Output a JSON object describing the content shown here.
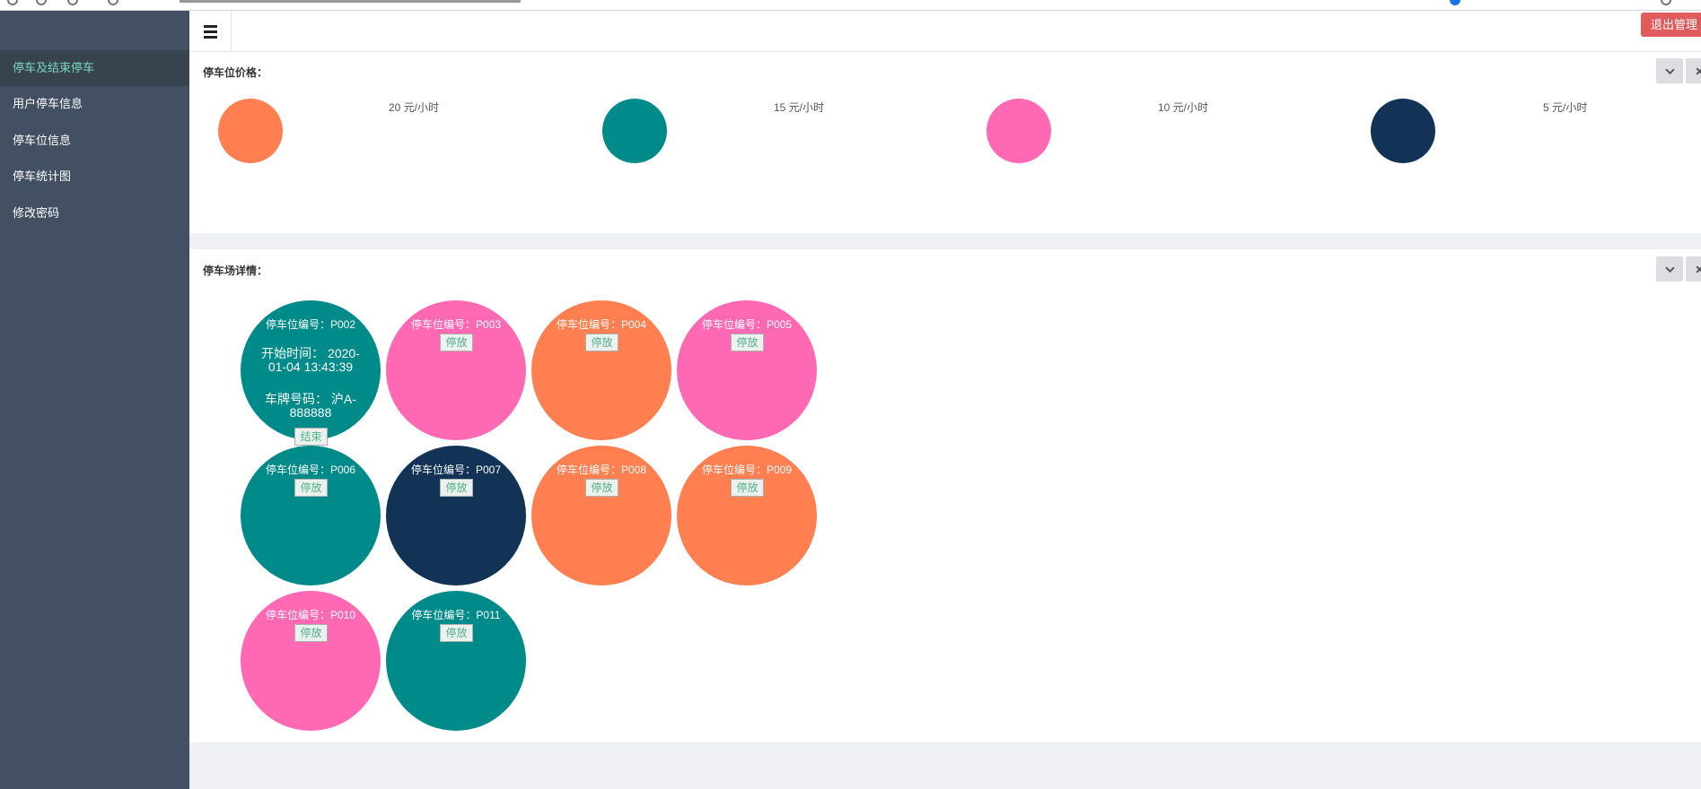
{
  "header": {
    "logout_label": "退出管理"
  },
  "sidebar": {
    "items": [
      {
        "label": "停车及结束停车",
        "active": true
      },
      {
        "label": "用户停车信息",
        "active": false
      },
      {
        "label": "停车位信息",
        "active": false
      },
      {
        "label": "停车统计图",
        "active": false
      },
      {
        "label": "修改密码",
        "active": false
      }
    ]
  },
  "price_panel": {
    "title": "停车位价格：",
    "prices": [
      {
        "label": "20 元/小时",
        "color": "#ff7f50"
      },
      {
        "label": "15 元/小时",
        "color": "#008b8a"
      },
      {
        "label": "10 元/小时",
        "color": "#ff69b4"
      },
      {
        "label": "5 元/小时",
        "color": "#123356"
      }
    ]
  },
  "lot_panel": {
    "title": "停车场详情：",
    "spots": [
      {
        "code": "停车位编号：P002",
        "color": "#008b8a",
        "occupied": true,
        "start_time": "开始时间： 2020-01-04 13:43:39",
        "plate": "车牌号码： 沪A-888888",
        "button": "结束"
      },
      {
        "code": "停车位编号：P003",
        "color": "#ff69b4",
        "occupied": false,
        "button": "停放"
      },
      {
        "code": "停车位编号：P004",
        "color": "#ff7f50",
        "occupied": false,
        "button": "停放"
      },
      {
        "code": "停车位编号：P005",
        "color": "#ff69b4",
        "occupied": false,
        "button": "停放"
      },
      {
        "code": "停车位编号：P006",
        "color": "#008b8a",
        "occupied": false,
        "button": "停放"
      },
      {
        "code": "停车位编号：P007",
        "color": "#123356",
        "occupied": false,
        "button": "停放"
      },
      {
        "code": "停车位编号：P008",
        "color": "#ff7f50",
        "occupied": false,
        "button": "停放"
      },
      {
        "code": "停车位编号：P009",
        "color": "#ff7f50",
        "occupied": false,
        "button": "停放"
      },
      {
        "code": "停车位编号：P010",
        "color": "#ff69b4",
        "occupied": false,
        "button": "停放"
      },
      {
        "code": "停车位编号：P011",
        "color": "#008b8a",
        "occupied": false,
        "button": "停放"
      }
    ]
  }
}
